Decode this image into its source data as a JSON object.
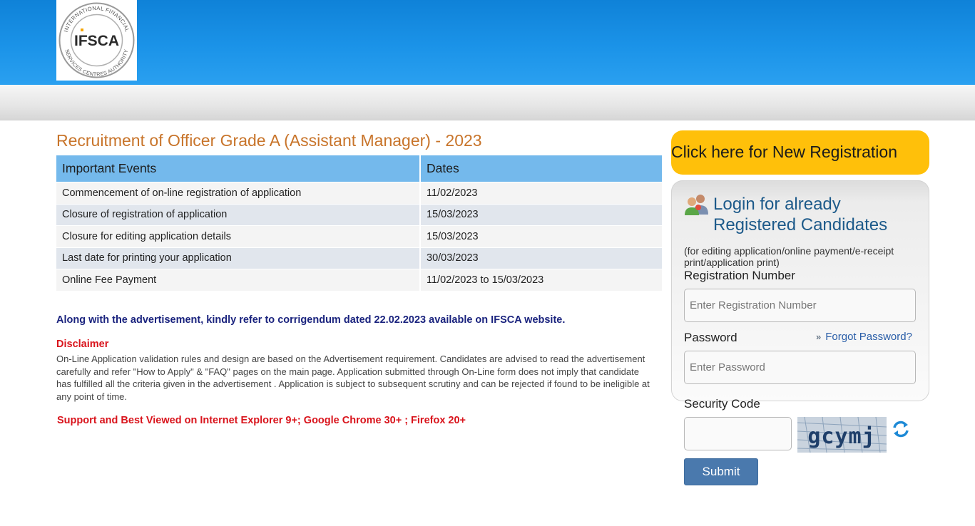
{
  "header": {
    "logo": {
      "org_short": "IFSCA",
      "ring_text": "INTERNATIONAL FINANCIAL SERVICES CENTRES AUTHORITY"
    }
  },
  "main": {
    "title": "Recruitment of Officer Grade A (Assistant Manager) - 2023",
    "table": {
      "headers": [
        "Important Events",
        "Dates"
      ],
      "rows": [
        {
          "event": "Commencement of on-line registration of application",
          "date": "11/02/2023"
        },
        {
          "event": "Closure of registration of application",
          "date": "15/03/2023"
        },
        {
          "event": "Closure for editing application details",
          "date": "15/03/2023"
        },
        {
          "event": "Last date for printing your application",
          "date": "30/03/2023"
        },
        {
          "event": "Online Fee Payment",
          "date": "11/02/2023 to 15/03/2023"
        }
      ]
    },
    "notice": "Along with the advertisement, kindly refer to corrigendum dated 22.02.2023 available on IFSCA website.",
    "disclaimer_title": "Disclaimer",
    "disclaimer_text": "On-Line Application validation rules and design are based on the Advertisement requirement. Candidates are advised to read the advertisement carefully and refer \"How to Apply\" & \"FAQ\" pages on the main page. Application submitted through On-Line form does not imply that candidate has fulfilled all the criteria given in the advertisement . Application is subject to subsequent scrutiny and can be rejected if found to be ineligible at any point of time.",
    "support": "Support and Best Viewed on Internet Explorer 9+; Google Chrome 30+ ; Firefox 20+"
  },
  "sidebar": {
    "new_registration": "Click here for New Registration",
    "login_title": "Login for already Registered Candidates",
    "login_subtitle": "(for editing application/online payment/e-receipt print/application print)",
    "registration_label": "Registration Number",
    "registration_placeholder": "Enter Registration Number",
    "password_label": "Password",
    "forgot_password": "Forgot Password?",
    "password_placeholder": "Enter Password",
    "security_label": "Security Code",
    "captcha_text": "gcymj",
    "submit_label": "Submit"
  },
  "colors": {
    "header_blue": "#1b93e8",
    "title_orange": "#c8742a",
    "table_header": "#74b9ec",
    "notice_navy": "#1a237e",
    "alert_red": "#d9141c",
    "cta_yellow": "#ffc00a",
    "submit_blue": "#4a79ad",
    "login_title_blue": "#1d5a8a"
  },
  "icons": {
    "users": "users-icon",
    "chevrons": "double-chevron-right-icon",
    "refresh": "refresh-icon"
  }
}
